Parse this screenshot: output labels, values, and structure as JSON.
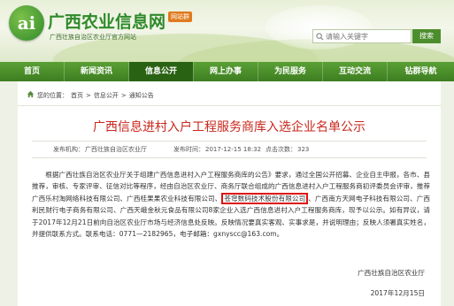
{
  "header": {
    "site_title": "广西农业信息网",
    "badge": "网站群",
    "subtitle": "广西壮族自治区农业厅官方网站",
    "logo_text": "ai",
    "search": {
      "placeholder": "请输入关键字",
      "button": "搜索"
    }
  },
  "nav": {
    "items": [
      {
        "label": "首页"
      },
      {
        "label": "新闻资讯"
      },
      {
        "label": "信息公开"
      },
      {
        "label": "网上办事"
      },
      {
        "label": "为民服务"
      },
      {
        "label": "互动交流"
      },
      {
        "label": "钻群导航"
      }
    ],
    "active_index": 2
  },
  "breadcrumb": {
    "prefix": "您的位置：",
    "items": [
      "首页",
      "信息公开",
      "通知公告"
    ],
    "separator": ">"
  },
  "article": {
    "title": "广西信息进村入户工程服务商库入选企业名单公示",
    "publisher_label": "发布机构：",
    "publisher": "广西壮族自治区农业厅",
    "time_label": "发布时间：",
    "time": "2017-12-15 18:32",
    "views_label": "点击次数：",
    "views": "323",
    "para_1": "根据广西壮族自治区农业厅关于组建广西信息进村入户工程服务商库的公告》要求，通过全国公开招募、企业自主申报，各市、县推荐，审核、专家评审、征信对比等程序，经由自治区农业厅、商务厅联合组成的广西信息进村入户工程服务商初评委员会评审，推荐广西乐村淘网络科技有限公司、广西桂果果农业科技有限公司、",
    "para_highlight": "苍穹数码技术股份有限公司",
    "para_2": "、广西南方天网电子科技有限公司、广西利民财行电子商务有限公司、广西天峨金秋元食品有限公司8家企业入选广西信息进村入户工程服务商库，现予以公示。如有异议，请于2017年12月21日前向自治区农业厅市场与经济信息处反映。反映情况要真实客观、实事求是，并说明理由；反映人须署真实姓名，并提供联系方式。联系电话：0771—2182965，电子邮箱：gxnyscc@163.com。",
    "signature": "广西壮族自治区农业厅",
    "sign_date": "2017年12月15日"
  },
  "colors": {
    "brand_green": "#2f8a2a",
    "nav_green": "#4c8e2d",
    "title_red": "#c8281e",
    "highlight_red": "#e01010"
  },
  "icons": [
    "logo-icon",
    "search-icon",
    "home-icon"
  ]
}
